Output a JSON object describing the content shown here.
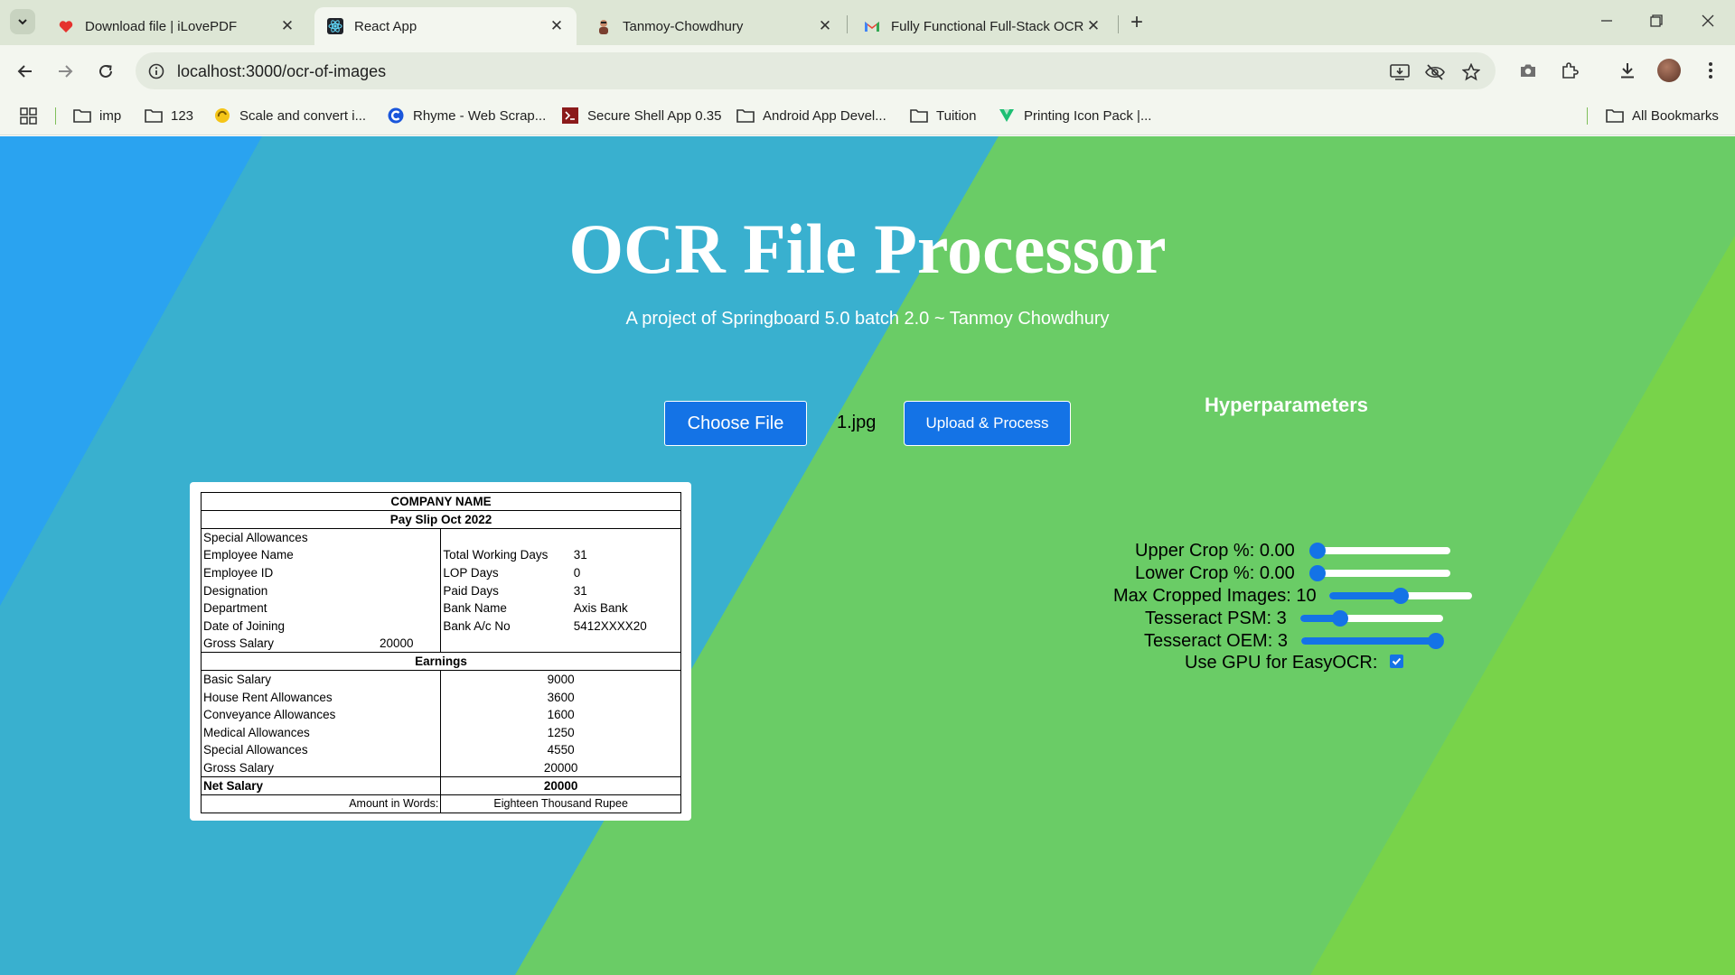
{
  "tabs": [
    {
      "title": "Download file | iLovePDF",
      "icon": "ilovepdf-heart-icon",
      "active": false
    },
    {
      "title": "React App",
      "icon": "react-icon",
      "active": true
    },
    {
      "title": "Tanmoy-Chowdhury",
      "icon": "github-avatar-icon",
      "active": false
    },
    {
      "title": "Fully Functional Full-Stack OCR",
      "icon": "gmail-icon",
      "active": false
    }
  ],
  "address_bar": {
    "url": "localhost:3000/ocr-of-images"
  },
  "bookmarks": [
    {
      "label": "imp",
      "icon": "folder-icon"
    },
    {
      "label": "123",
      "icon": "folder-icon"
    },
    {
      "label": "Scale and convert i...",
      "icon": "scale-convert-icon"
    },
    {
      "label": "Rhyme - Web Scrap...",
      "icon": "rhyme-icon"
    },
    {
      "label": "Secure Shell App 0.35",
      "icon": "ssh-icon"
    },
    {
      "label": "Android App Devel...",
      "icon": "folder-icon"
    },
    {
      "label": "Tuition",
      "icon": "folder-icon"
    },
    {
      "label": "Printing Icon Pack |...",
      "icon": "vuetify-icon"
    },
    {
      "label": "All Bookmarks",
      "icon": "folder-icon"
    }
  ],
  "app": {
    "title": "OCR File Processor",
    "subtitle": "A project of Springboard 5.0 batch 2.0 ~ Tanmoy Chowdhury",
    "choose_file_label": "Choose File",
    "file_name": "1.jpg",
    "upload_label": "Upload & Process"
  },
  "payslip": {
    "company": "COMPANY NAME",
    "period": "Pay Slip Oct 2022",
    "first_line": "Special Allowances",
    "left_info": [
      {
        "label": "Employee Name",
        "value": ""
      },
      {
        "label": "Employee ID",
        "value": ""
      },
      {
        "label": "Designation",
        "value": ""
      },
      {
        "label": "Department",
        "value": ""
      },
      {
        "label": "Date of Joining",
        "value": ""
      },
      {
        "label": "Gross Salary",
        "value": "20000"
      }
    ],
    "right_info": [
      {
        "label": "Total Working Days",
        "value": "31"
      },
      {
        "label": "LOP Days",
        "value": "0"
      },
      {
        "label": "Paid Days",
        "value": "31"
      },
      {
        "label": "Bank Name",
        "value": "Axis Bank"
      },
      {
        "label": "Bank A/c No",
        "value": "5412XXXX20"
      }
    ],
    "earnings_header": "Earnings",
    "earnings": [
      {
        "label": "Basic Salary",
        "value": "9000"
      },
      {
        "label": "House Rent Allowances",
        "value": "3600"
      },
      {
        "label": "Conveyance Allowances",
        "value": "1600"
      },
      {
        "label": "Medical Allowances",
        "value": "1250"
      },
      {
        "label": "Special Allowances",
        "value": "4550"
      },
      {
        "label": "Gross Salary",
        "value": "20000"
      }
    ],
    "net_salary": {
      "label": "Net Salary",
      "value": "20000"
    },
    "amount_words": {
      "label": "Amount in Words:",
      "value": "Eighteen Thousand Rupee"
    }
  },
  "hyperparameters": {
    "title": "Hyperparameters",
    "upper_crop": {
      "label": "Upper Crop %: 0.00",
      "level": 0.0
    },
    "lower_crop": {
      "label": "Lower Crop %: 0.00",
      "level": 0.0
    },
    "max_cropped": {
      "label": "Max Cropped Images: 10",
      "level": 0.5
    },
    "tesseract_psm": {
      "label": "Tesseract PSM: 3",
      "level": 0.25
    },
    "tesseract_oem": {
      "label": "Tesseract OEM: 3",
      "level": 1.0
    },
    "use_gpu": {
      "label": "Use GPU for EasyOCR:",
      "checked": true
    }
  },
  "colors": {
    "accent": "#1473e6",
    "bg_blue": "#2aa4ee",
    "bg_green": "#6ccd66"
  }
}
